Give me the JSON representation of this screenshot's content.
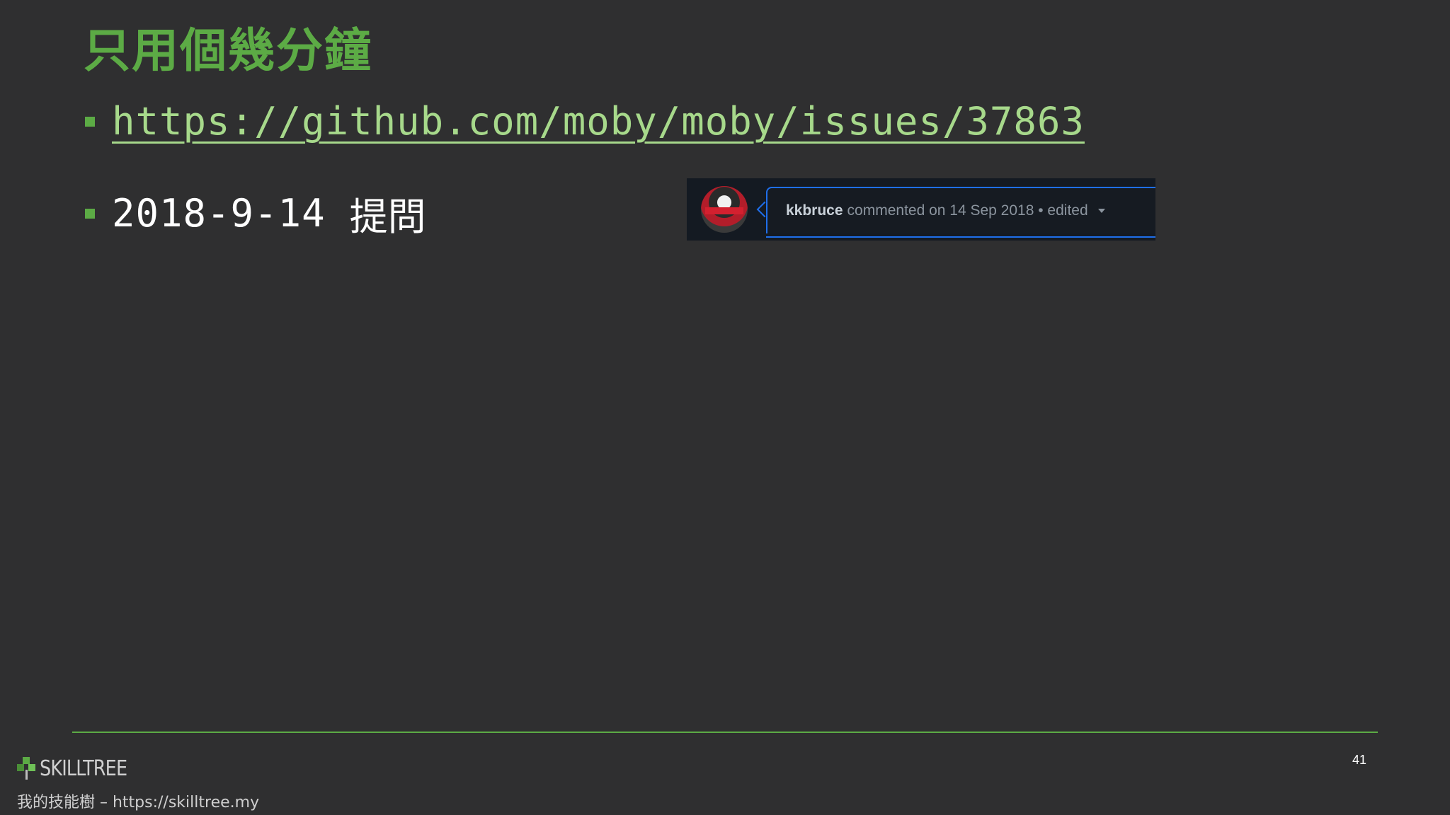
{
  "slide": {
    "title": "只用個幾分鐘",
    "bullets": {
      "link": "https://github.com/moby/moby/issues/37863",
      "date": "2018-9-14",
      "ask": "提問"
    },
    "github_comment": {
      "username": "kkbruce",
      "meta": "commented on 14 Sep 2018 • edited"
    },
    "page_number": "41"
  },
  "footer": {
    "logo_text": "SKILLTREE",
    "caption": "我的技能樹 – https://skilltree.my"
  },
  "colors": {
    "background": "#2f2f30",
    "accent_green": "#5cab45",
    "link_green": "#a7d98b",
    "github_blue": "#1f6feb"
  }
}
